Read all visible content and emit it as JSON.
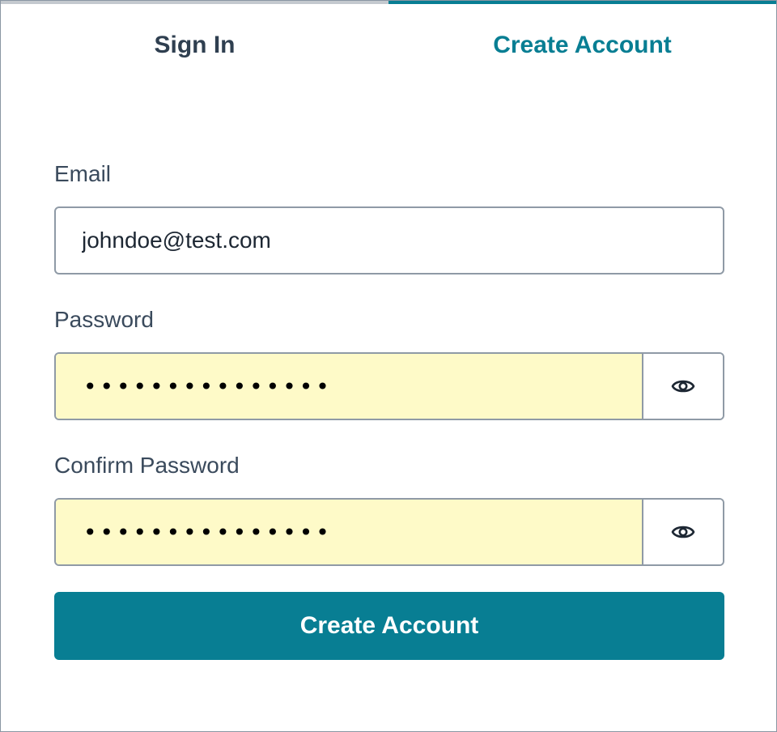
{
  "tabs": {
    "sign_in": "Sign In",
    "create_account": "Create Account",
    "active": "create_account"
  },
  "form": {
    "email": {
      "label": "Email",
      "value": "johndoe@test.com"
    },
    "password": {
      "label": "Password",
      "value": "•••••••••••••••",
      "toggle_icon": "eye-icon"
    },
    "confirm_password": {
      "label": "Confirm Password",
      "value": "•••••••••••••••",
      "toggle_icon": "eye-icon"
    },
    "submit_label": "Create Account"
  },
  "colors": {
    "accent": "#087e93",
    "autofill_background": "#fefac8",
    "text": "#2f3f50",
    "border": "#8f9aa6"
  }
}
